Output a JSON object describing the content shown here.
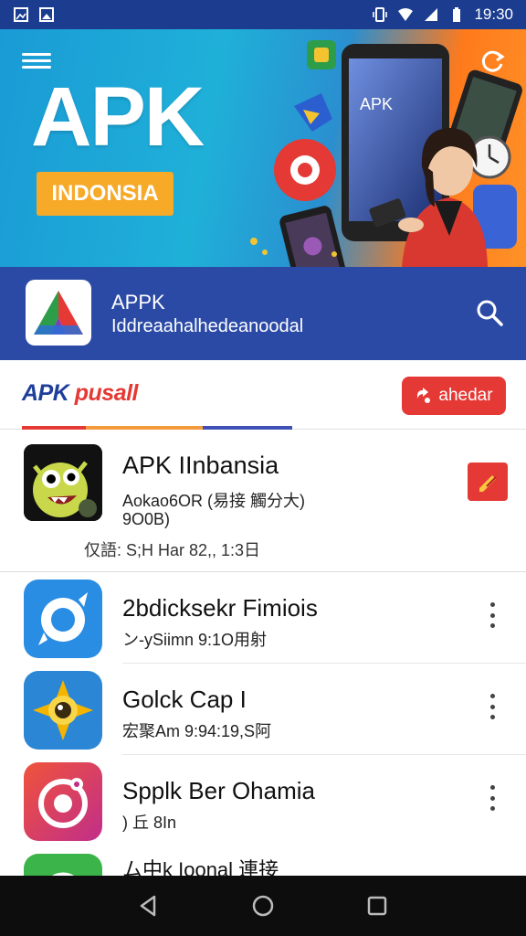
{
  "status_bar": {
    "time": "19:30"
  },
  "banner": {
    "title": "APK",
    "badge": "INDONSIA",
    "phone_text": "APK"
  },
  "app_header": {
    "name": "APPK",
    "tagline": "Iddreaahalhedeanoodal"
  },
  "sub_header": {
    "brand_part1": "APK",
    "brand_part2": " pusall",
    "action_label": "ahedar",
    "tab_colors": [
      "#e53935",
      "#f39a3c",
      "#3f51b5"
    ]
  },
  "featured": {
    "title": "APK IInbansia",
    "sub1": "Aokao6OR (易接 觸分大)",
    "sub2": "9O0B)",
    "meta": "仅語: S;H Har 82,, 1:3日"
  },
  "list": {
    "items": [
      {
        "title": "2bdicksekr Fimiois",
        "subtitle": "ン-ySiimn 9:1O用射",
        "icon": "swirl-icon",
        "color": "#2a8de4"
      },
      {
        "title": "Golck Cap I",
        "subtitle": "宏聚Am 9:94:19,S阿",
        "icon": "sun-eye-icon",
        "color": "#2b86d6"
      },
      {
        "title": "Spplk Ber Ohamia",
        "subtitle": ") 丘 8In",
        "icon": "face-icon",
        "color": "#e84a4a"
      },
      {
        "title": "ム中k Ioonal 連接",
        "subtitle": "",
        "icon": "green-app-icon",
        "color": "#3bb54a"
      }
    ]
  },
  "colors": {
    "status_bar": "#1b3c8f",
    "header": "#2b4aa6",
    "accent_red": "#e53935",
    "brand_blue": "#1f3f9a"
  }
}
